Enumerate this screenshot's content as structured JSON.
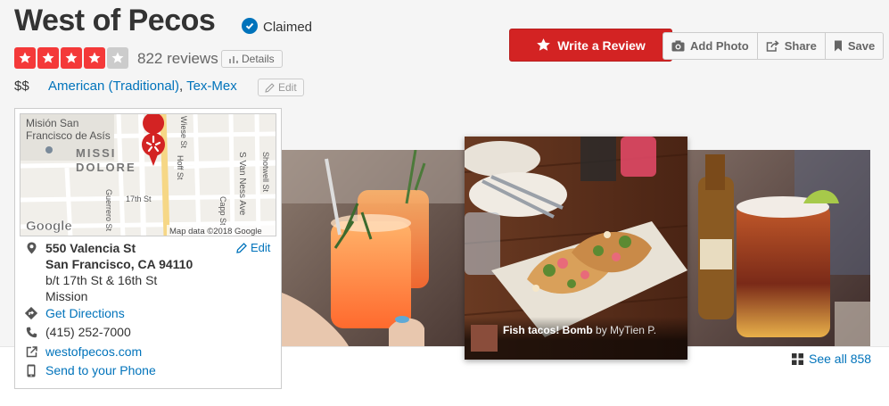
{
  "business": {
    "name": "West of Pecos",
    "claimed_label": "Claimed",
    "rating": 4,
    "rating_max": 5,
    "review_count": "822 reviews",
    "details_label": "Details",
    "price": "$$",
    "categories": [
      "American (Traditional)",
      "Tex-Mex"
    ],
    "edit_label": "Edit"
  },
  "actions": {
    "write_review": "Write a Review",
    "add_photo": "Add Photo",
    "share": "Share",
    "save": "Save"
  },
  "map_card": {
    "map_labels": {
      "area1": "Misión San",
      "area2": "Francisco de Asís",
      "district1": "MISSI",
      "district2": "DOLORE",
      "street_guerrero": "Guerrero St",
      "street_17th": "17th St",
      "street_hoff": "Hoff St",
      "street_wiese": "Wiese St",
      "street_van_ness": "S Van Ness Ave",
      "street_capp": "Capp St",
      "street_shotwell": "Shotwell St",
      "google": "Google",
      "attribution": "Map data ©2018 Google"
    },
    "address_line1": "550 Valencia St",
    "address_line2": "San Francisco, CA 94110",
    "cross_streets": "b/t 17th St & 16th St",
    "neighborhood": "Mission",
    "edit_label": "Edit",
    "directions_label": "Get Directions",
    "phone": "(415) 252-7000",
    "website": "westofpecos.com",
    "send_to_phone": "Send to your Phone"
  },
  "photos": {
    "caption_title": "Fish tacos! Bomb",
    "caption_by": "by MyTien P.",
    "see_all": "See all 858"
  },
  "colors": {
    "brand_red": "#d32323",
    "star_red": "#f43939",
    "link_blue": "#0073bb"
  }
}
